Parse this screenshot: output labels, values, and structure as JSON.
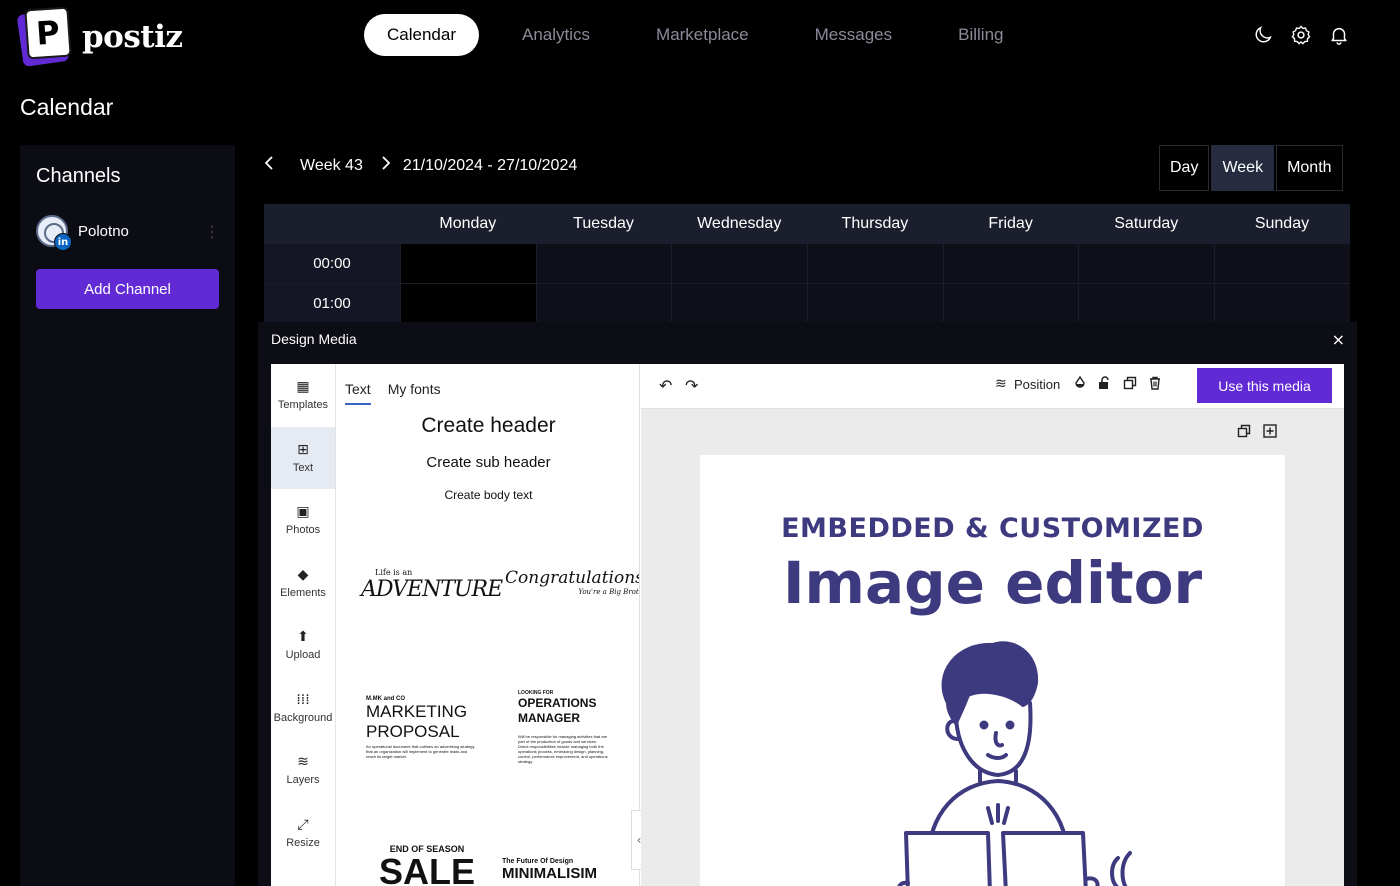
{
  "app": {
    "logo_letter": "P",
    "logo_text": "postiz"
  },
  "nav": {
    "items": [
      {
        "label": "Calendar",
        "active": true
      },
      {
        "label": "Analytics",
        "active": false
      },
      {
        "label": "Marketplace",
        "active": false
      },
      {
        "label": "Messages",
        "active": false
      },
      {
        "label": "Billing",
        "active": false
      }
    ],
    "icons": [
      "moon-icon",
      "gear-icon",
      "bell-icon"
    ]
  },
  "page": {
    "title": "Calendar"
  },
  "sidebar": {
    "title": "Channels",
    "channels": [
      {
        "name": "Polotno",
        "network_badge": "in"
      }
    ],
    "add_button": "Add Channel"
  },
  "calendar": {
    "week_label": "Week 43",
    "date_range": "21/10/2024 - 27/10/2024",
    "views": [
      {
        "label": "Day",
        "active": false
      },
      {
        "label": "Week",
        "active": true
      },
      {
        "label": "Month",
        "active": false
      }
    ],
    "days": [
      "Monday",
      "Tuesday",
      "Wednesday",
      "Thursday",
      "Friday",
      "Saturday",
      "Sunday"
    ],
    "times": [
      "00:00",
      "01:00"
    ]
  },
  "modal": {
    "title": "Design Media",
    "close": "×",
    "side_tabs": [
      {
        "label": "Templates",
        "icon": "templates-icon",
        "glyph": "▦",
        "active": false
      },
      {
        "label": "Text",
        "icon": "text-icon",
        "glyph": "⊞",
        "active": true
      },
      {
        "label": "Photos",
        "icon": "photos-icon",
        "glyph": "▣",
        "active": false
      },
      {
        "label": "Elements",
        "icon": "elements-icon",
        "glyph": "◆",
        "active": false
      },
      {
        "label": "Upload",
        "icon": "upload-icon",
        "glyph": "⬆",
        "active": false
      },
      {
        "label": "Background",
        "icon": "background-icon",
        "glyph": "⁞⁞⁞",
        "active": false
      },
      {
        "label": "Layers",
        "icon": "layers-icon",
        "glyph": "≋",
        "active": false
      },
      {
        "label": "Resize",
        "icon": "resize-icon",
        "glyph": "⤢",
        "active": false
      }
    ],
    "panel": {
      "tabs": [
        {
          "label": "Text",
          "active": true
        },
        {
          "label": "My fonts",
          "active": false
        }
      ],
      "create_header": "Create header",
      "create_sub_header": "Create sub header",
      "create_body": "Create body text",
      "templates": {
        "adventure_small": "Life is an",
        "adventure_big": "ADVENTURE",
        "congrats_big": "Congratulations!",
        "congrats_small": "You're a Big Brother",
        "marketing_top": "M.MK and CO",
        "marketing_title_1": "MARKETING",
        "marketing_title_2": "PROPOSAL",
        "marketing_body": "An operational document that outlines an advertising strategy that an organization will implement to generate leads and reach its target market.",
        "ops_top": "LOOKING FOR",
        "ops_title_1": "OPERATIONS",
        "ops_title_2": "MANAGER",
        "ops_body": "Will be responsible for managing activities that are part of the production of goods and services. Direct responsibilities include managing both the operations process, embracing design, planning, control, performance improvement, and operations strategy.",
        "sale_top": "END OF SEASON",
        "sale_big": "SALE",
        "minimal_top": "The Future Of Design",
        "minimal_big": "MINIMALISIM"
      }
    },
    "toolbar": {
      "position_label": "Position",
      "use_button": "Use this media"
    },
    "canvas": {
      "eyebrow": "EMBEDDED & CUSTOMIZED",
      "title": "Image editor"
    }
  }
}
